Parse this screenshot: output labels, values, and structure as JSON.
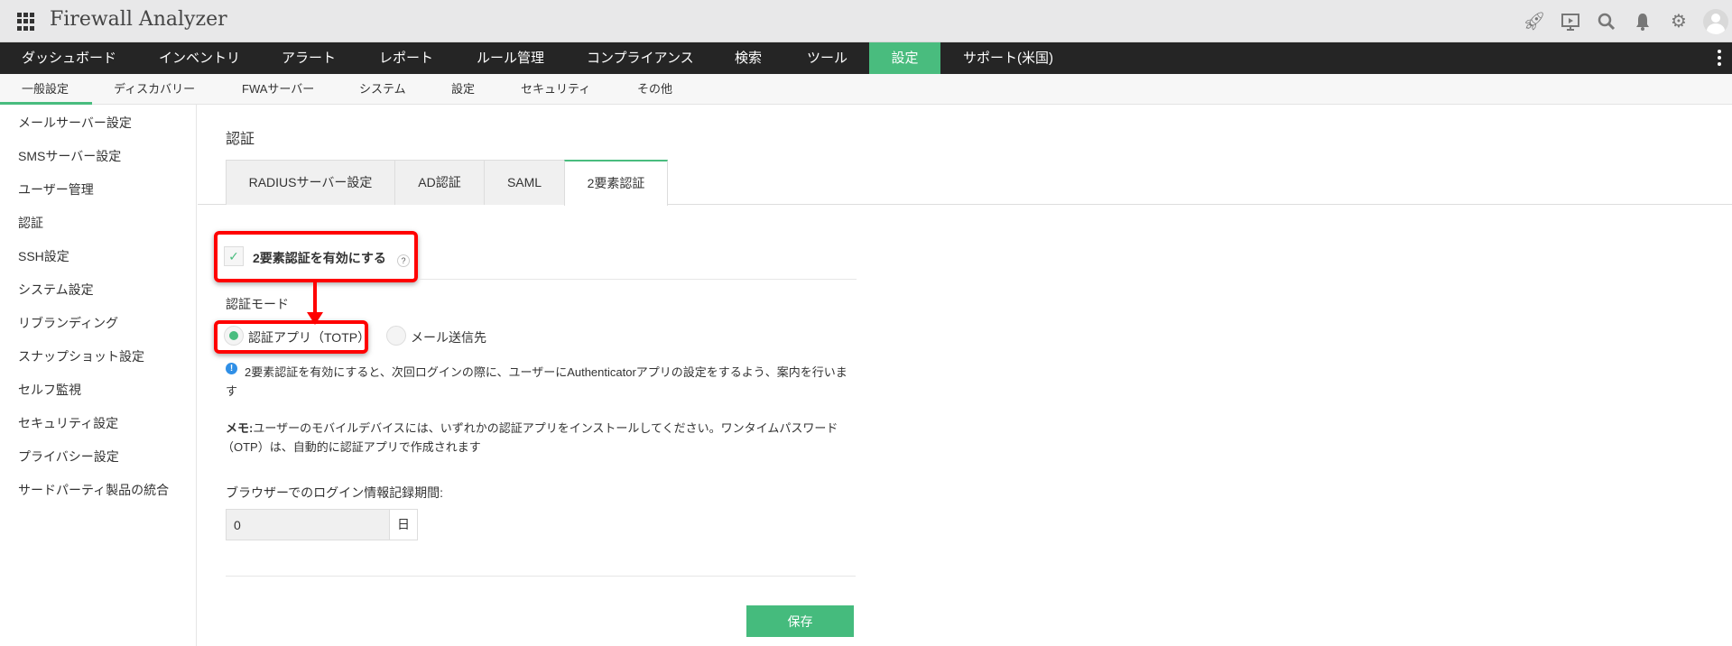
{
  "app": {
    "title": "Firewall Analyzer"
  },
  "header_icons": [
    "rocket-icon",
    "presentation-icon",
    "search-icon",
    "bell-icon",
    "gear-icon",
    "user-avatar-icon"
  ],
  "nav": [
    "ダッシュボード",
    "インベントリ",
    "アラート",
    "レポート",
    "ルール管理",
    "コンプライアンス",
    "検索",
    "ツール",
    "設定",
    "サポート(米国)"
  ],
  "nav_active": "設定",
  "subnav": [
    "一般設定",
    "ディスカバリー",
    "FWAサーバー",
    "システム",
    "設定",
    "セキュリティ",
    "その他"
  ],
  "subnav_active": "一般設定",
  "sidebar": [
    "メールサーバー設定",
    "SMSサーバー設定",
    "ユーザー管理",
    "認証",
    "SSH設定",
    "システム設定",
    "リブランディング",
    "スナップショット設定",
    "セルフ監視",
    "セキュリティ設定",
    "プライバシー設定",
    "サードパーティ製品の統合"
  ],
  "main": {
    "title": "認証",
    "tabs": [
      "RADIUSサーバー設定",
      "AD認証",
      "SAML",
      "2要素認証"
    ],
    "active_tab": "2要素認証",
    "enable_label": "2要素認証を有効にする",
    "enable_checked": true,
    "help": "?",
    "mode_label": "認証モード",
    "modes": [
      "認証アプリ（TOTP）",
      "メール送信先"
    ],
    "selected_mode": "認証アプリ（TOTP）",
    "info_line1": "2要素認証を有効にすると、次回ログインの際に、ユーザーにAuthenticatorアプリの設定をするよう、案内を行いま",
    "info_line2": "す",
    "memo_bold": "メモ:",
    "memo_line1": "ユーザーのモバイルデバイスには、いずれかの認証アプリをインストールしてください。ワンタイムパスワード",
    "memo_line2": "（OTP）は、自動的に認証アプリで作成されます",
    "remember_label": "ブラウザーでのログイン情報記録期間:",
    "remember_value": "0",
    "remember_unit": "日",
    "save": "保存"
  },
  "colors": {
    "accent": "#49bc7e",
    "nav_bg": "#252525",
    "highlight": "#ff0000"
  }
}
